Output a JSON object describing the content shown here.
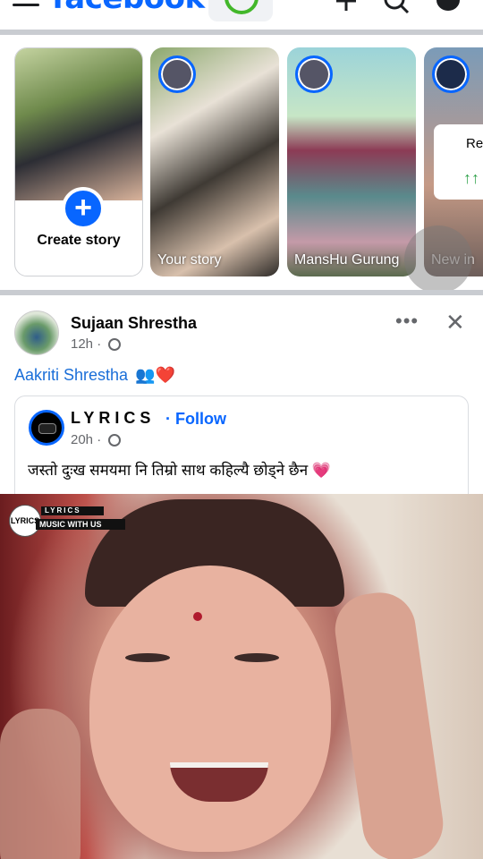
{
  "app": {
    "logo": "facebook"
  },
  "stories": {
    "create_label": "Create story",
    "items": [
      {
        "name": "Your story"
      },
      {
        "name": "MansHu Gurung"
      },
      {
        "name": "New in"
      }
    ],
    "card_text": "Re incr",
    "card_arrow": "↑↑"
  },
  "post": {
    "author": "Sujaan Shrestha",
    "time": "12h",
    "more_label": "•••",
    "close_label": "✕",
    "caption_name": "Aakriti Shrestha",
    "caption_emoji": "👥❤️",
    "shared": {
      "page_name": "LYRICS",
      "follow_label": "· Follow",
      "time": "20h",
      "text": "जस्तो दुःख समयमा नि तिम्रो साथ कहिल्यै छोड्ने छैन",
      "emoji": "💗"
    },
    "video": {
      "watermark_circle": "LYRICS",
      "watermark_line1": "LYRICS",
      "watermark_line2": "MUSIC WITH US"
    }
  }
}
